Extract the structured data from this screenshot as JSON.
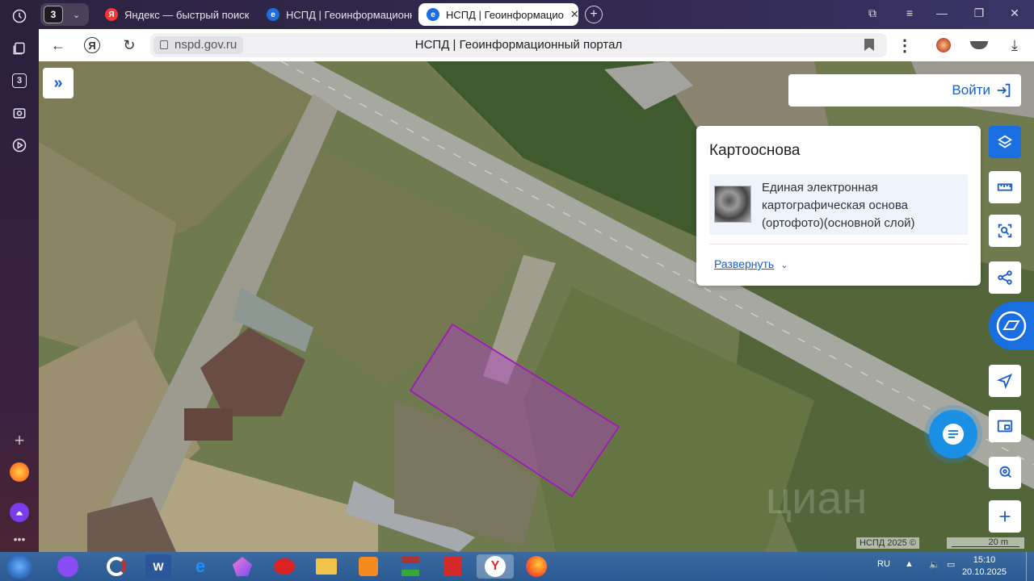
{
  "tabbar": {
    "group_count": "3",
    "tabs": [
      {
        "title": "Яндекс — быстрый поиск",
        "fav": "Я"
      },
      {
        "title": "НСПД | Геоинформационн"
      },
      {
        "title": "НСПД | Геоинформацио"
      }
    ]
  },
  "sidebar": {
    "tab_count": "3"
  },
  "address": {
    "domain": "nspd.gov.ru",
    "page_title": "НСПД | Геоинформационный портал"
  },
  "portal": {
    "login_label": "Войти",
    "basemap_panel": {
      "title": "Картооснова",
      "layer_name": "Единая электронная картографическая основа (ортофото)(основной слой)",
      "expand_label": "Развернуть"
    },
    "copyright": "НСПД 2025 ©",
    "scale_label": "20 m"
  },
  "taskbar": {
    "lang": "RU",
    "time": "15:10",
    "date": "20.10.2025"
  },
  "colors": {
    "accent": "#1a6fe0",
    "parcel_outline": "#a018b8",
    "parcel_fill": "#b040c8"
  }
}
